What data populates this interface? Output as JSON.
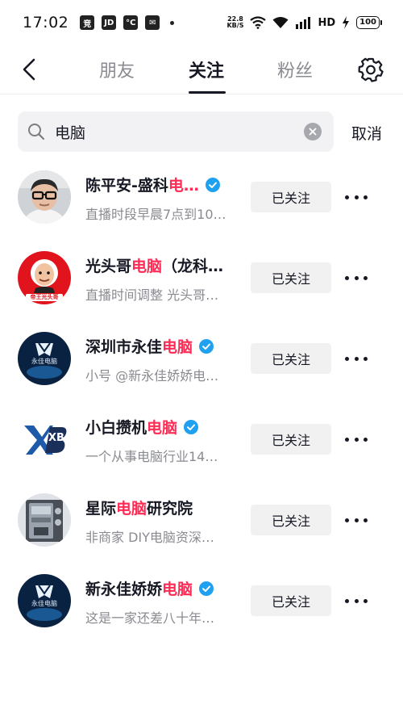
{
  "status_bar": {
    "time": "17:02",
    "apps": [
      "竞",
      "JD",
      "°C",
      "✉"
    ],
    "net_speed_value": "22.8",
    "net_speed_unit": "KB/S",
    "network": "HD",
    "battery": "100"
  },
  "nav": {
    "tabs": [
      "朋友",
      "关注",
      "粉丝"
    ],
    "active_tab": "关注"
  },
  "search": {
    "query": "电脑",
    "cancel_label": "取消"
  },
  "colors": {
    "highlight": "#fe2c55",
    "verified": "#20a0f0",
    "secondary_text": "#8a8b91"
  },
  "users": [
    {
      "name_parts": [
        {
          "text": "陈平安-盛科",
          "hl": false
        },
        {
          "text": "电…",
          "hl": true
        }
      ],
      "verified": true,
      "desc": "直播时段早晨7点到10…",
      "follow_label": "已关注",
      "avatar": "man-with-glasses"
    },
    {
      "name_parts": [
        {
          "text": "光头哥",
          "hl": false
        },
        {
          "text": "电脑",
          "hl": true
        },
        {
          "text": "（龙科…",
          "hl": false
        }
      ],
      "verified": false,
      "desc": "直播时间调整 光头哥…",
      "follow_label": "已关注",
      "avatar": "red-cartoon",
      "avatar_text": "帝王光头哥"
    },
    {
      "name_parts": [
        {
          "text": "深圳市永佳",
          "hl": false
        },
        {
          "text": "电脑",
          "hl": true
        }
      ],
      "verified": true,
      "desc": "小号  @新永佳娇娇电…",
      "follow_label": "已关注",
      "avatar": "yj-logo",
      "avatar_text": "永佳电脑"
    },
    {
      "name_parts": [
        {
          "text": "小白攒机",
          "hl": false
        },
        {
          "text": "电脑",
          "hl": true
        }
      ],
      "verified": true,
      "desc": "一个从事电脑行业14…",
      "follow_label": "已关注",
      "avatar": "xb-logo",
      "avatar_text": "XB"
    },
    {
      "name_parts": [
        {
          "text": "星际",
          "hl": false
        },
        {
          "text": "电脑",
          "hl": true
        },
        {
          "text": "研究院",
          "hl": false
        }
      ],
      "verified": false,
      "desc": "非商家 DIY电脑资深…",
      "follow_label": "已关注",
      "avatar": "pc-case"
    },
    {
      "name_parts": [
        {
          "text": "新永佳娇娇",
          "hl": false
        },
        {
          "text": "电脑",
          "hl": true
        }
      ],
      "verified": true,
      "desc": "这是一家还差八十年…",
      "follow_label": "已关注",
      "avatar": "yj-logo",
      "avatar_text": "永佳电脑"
    }
  ]
}
